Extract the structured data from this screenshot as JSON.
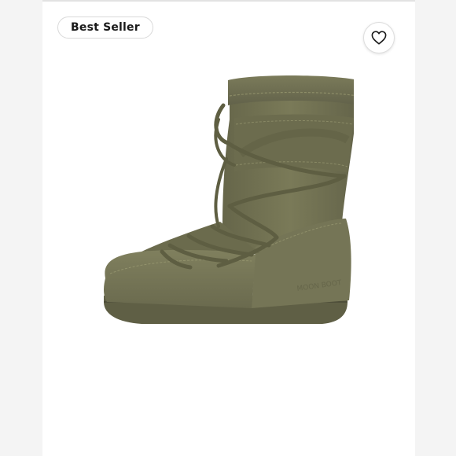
{
  "badge": {
    "label": "Best Seller"
  },
  "favorite": {
    "icon": "heart-outline-icon"
  },
  "product": {
    "image_alt": "Olive green lace-up snow boot",
    "color": "#6f6f4d",
    "brand_emboss": "MOON BOOT"
  },
  "colors": {
    "background": "#f6f6f6",
    "card": "#ffffff",
    "boot_main": "#707050",
    "boot_dark": "#5d5d3f",
    "boot_light": "#858560"
  }
}
